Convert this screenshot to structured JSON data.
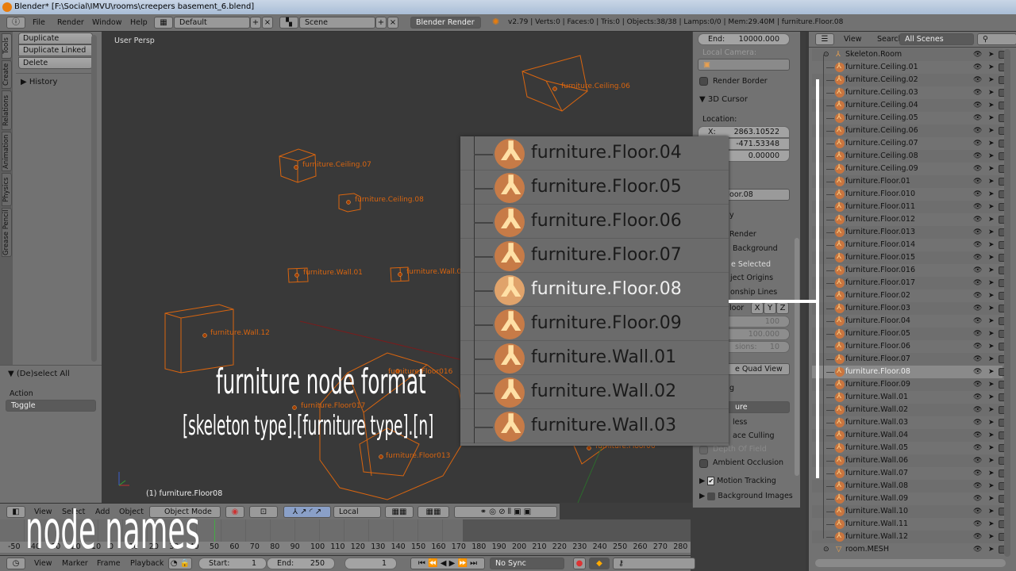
{
  "window": {
    "title": "Blender* [F:\\Social\\IMVU\\rooms\\creepers basement_6.blend]"
  },
  "topbar": {
    "menus": [
      "File",
      "Render",
      "Window",
      "Help"
    ],
    "layout": "Default",
    "scene": "Scene",
    "engine": "Blender Render",
    "info": "v2.79 | Verts:0 | Faces:0 | Tris:0 | Objects:38/38 | Lamps:0/0 | Mem:29.40M | furniture.Floor.08"
  },
  "tool_tabs": [
    "Tools",
    "Create",
    "Relations",
    "Animation",
    "Physics",
    "Grease Pencil"
  ],
  "tool_panel": {
    "buttons": [
      "Duplicate",
      "Duplicate Linked",
      "Delete"
    ],
    "history": "History"
  },
  "operator_panel": {
    "title": "(De)select All",
    "action_label": "Action",
    "action_value": "Toggle"
  },
  "viewport": {
    "view_name": "User Persp",
    "active_label": "(1) furniture.Floor08",
    "object_labels": [
      "furniture.Ceiling.06",
      "furniture.Ceiling.07",
      "furniture.Ceiling.08",
      "furniture.Wall.01",
      "furniture.Wall.02",
      "furniture.Wall.12",
      "furniture.Floor016",
      "furniture.Floor017",
      "furniture.Floor013",
      "furniture.Floor06"
    ]
  },
  "properties": {
    "clip_end_label": "End:",
    "clip_end": "10000.000",
    "local_camera": "Local Camera:",
    "render_border": "Render Border",
    "cursor_section": "3D Cursor",
    "location": "Location:",
    "x_label": "X:",
    "x": "2863.10522",
    "y": "-471.53348",
    "z": "0.00000",
    "partial": [
      "iture.Floor.08",
      "y",
      "Render",
      "Background",
      "e Selected",
      "ject Origins",
      "onship Lines",
      "loor",
      "X",
      "Y",
      "Z",
      "100",
      "100.000",
      "sions:",
      "10",
      "e Quad View",
      "g",
      "ure",
      "less",
      "ace Culling"
    ],
    "depth_of_field": "Depth Of Field",
    "ambient_occlusion": "Ambient Occlusion",
    "motion_tracking": "Motion Tracking",
    "background_images": "Background Images"
  },
  "outliner": {
    "menus": [
      "View",
      "Search"
    ],
    "filter": "All Scenes",
    "root": "Skeleton.Room",
    "selected": "furniture.Floor.08",
    "items": [
      "furniture.Ceiling.01",
      "furniture.Ceiling.02",
      "furniture.Ceiling.03",
      "furniture.Ceiling.04",
      "furniture.Ceiling.05",
      "furniture.Ceiling.06",
      "furniture.Ceiling.07",
      "furniture.Ceiling.08",
      "furniture.Ceiling.09",
      "furniture.Floor.01",
      "furniture.Floor.010",
      "furniture.Floor.011",
      "furniture.Floor.012",
      "furniture.Floor.013",
      "furniture.Floor.014",
      "furniture.Floor.015",
      "furniture.Floor.016",
      "furniture.Floor.017",
      "furniture.Floor.02",
      "furniture.Floor.03",
      "furniture.Floor.04",
      "furniture.Floor.05",
      "furniture.Floor.06",
      "furniture.Floor.07",
      "furniture.Floor.08",
      "furniture.Floor.09",
      "furniture.Wall.01",
      "furniture.Wall.02",
      "furniture.Wall.03",
      "furniture.Wall.04",
      "furniture.Wall.05",
      "furniture.Wall.06",
      "furniture.Wall.07",
      "furniture.Wall.08",
      "furniture.Wall.09",
      "furniture.Wall.10",
      "furniture.Wall.11",
      "furniture.Wall.12"
    ],
    "mesh": "room.MESH"
  },
  "popup": {
    "items": [
      "furniture.Floor.04",
      "furniture.Floor.05",
      "furniture.Floor.06",
      "furniture.Floor.07",
      "furniture.Floor.08",
      "furniture.Floor.09",
      "furniture.Wall.01",
      "furniture.Wall.02",
      "furniture.Wall.03"
    ],
    "selected_index": 4
  },
  "view3d_header": {
    "menus": [
      "View",
      "Select",
      "Add",
      "Object"
    ],
    "mode": "Object Mode",
    "orientation": "Local"
  },
  "timeline": {
    "ruler": [
      "-50",
      "-40",
      "-30",
      "-20",
      "-10",
      "0",
      "10",
      "20",
      "30",
      "40",
      "50",
      "60",
      "70",
      "80",
      "90",
      "100",
      "110",
      "120",
      "130",
      "140",
      "150",
      "160",
      "170",
      "180",
      "190",
      "200",
      "210",
      "220",
      "230",
      "240",
      "250",
      "260",
      "270",
      "280"
    ],
    "menus": [
      "View",
      "Marker",
      "Frame",
      "Playback"
    ],
    "start_label": "Start:",
    "start": "1",
    "end_label": "End:",
    "end": "250",
    "current": "1",
    "sync": "No Sync"
  },
  "annotations": {
    "title": "furniture node format",
    "format": "[skeleton type].[furniture type].[n]",
    "node_names": "node names"
  },
  "colors": {
    "accent_orange": "#e87d0d",
    "wire": "#d9650f",
    "viewport_bg": "#393939",
    "panel": "#727272"
  }
}
